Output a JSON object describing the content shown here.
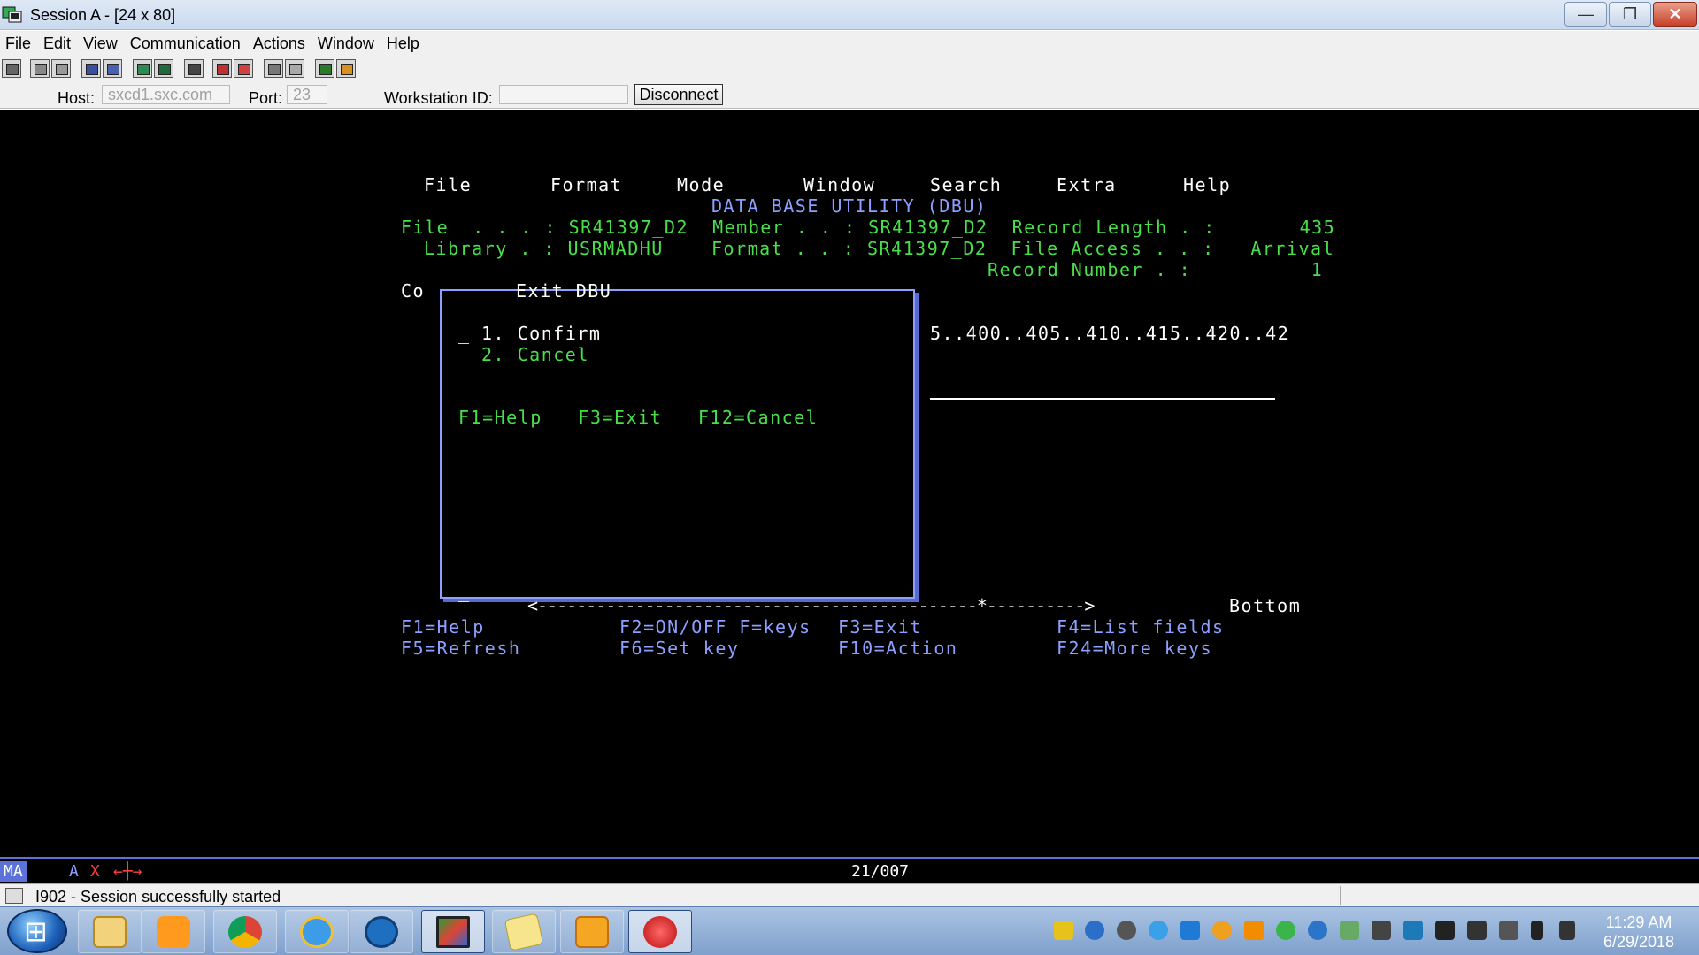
{
  "window": {
    "title": "Session A - [24 x 80]",
    "controls": {
      "minimize": "—",
      "maximize": "❐",
      "close": "✕"
    }
  },
  "menubar": [
    "File",
    "Edit",
    "View",
    "Communication",
    "Actions",
    "Window",
    "Help"
  ],
  "hostbar": {
    "host_label": "Host:",
    "host_value": "sxcd1.sxc.com",
    "port_label": "Port:",
    "port_value": "23",
    "workstation_label": "Workstation ID:",
    "workstation_value": "",
    "disconnect_label": "Disconnect"
  },
  "terminal": {
    "menu": [
      "File",
      "Format",
      "Mode",
      "Window",
      "Search",
      "Extra",
      "Help"
    ],
    "title": "DATA BASE UTILITY (DBU)",
    "file_line": "File  . . . : SR41397_D2  Member . . : SR41397_D2  Record Length . :       435",
    "library_line": "Library . : USRMADHU    Format . . : SR41397_D2  File Access . . :   Arrival",
    "record_number_line": "Record Number . :          1",
    "co_label": "Co",
    "ruler": "5..400..405..410..415..420..42",
    "popup": {
      "title": "Exit DBU",
      "cursor": "_",
      "options": [
        "1. Confirm",
        "2. Cancel"
      ],
      "fkeys": "F1=Help   F3=Exit   F12=Cancel"
    },
    "cursor2": "_",
    "scroll_line": "<---------------------------------------------*---------->",
    "scroll_position": "Bottom",
    "fkeys_row1": [
      "F1=Help",
      "F2=ON/OFF F=keys",
      "F3=Exit",
      "F4=List fields"
    ],
    "fkeys_row2": [
      "F5=Refresh",
      "F6=Set key",
      "F10=Action",
      "F24=More keys"
    ]
  },
  "oia": {
    "mode": "MA",
    "session": "A",
    "error": "X",
    "indicator": "←┼→",
    "cursor_position": "21/007"
  },
  "status": {
    "message": "I902 - Session successfully started"
  },
  "taskbar": {
    "time": "11:29 AM",
    "date": "6/29/2018"
  }
}
